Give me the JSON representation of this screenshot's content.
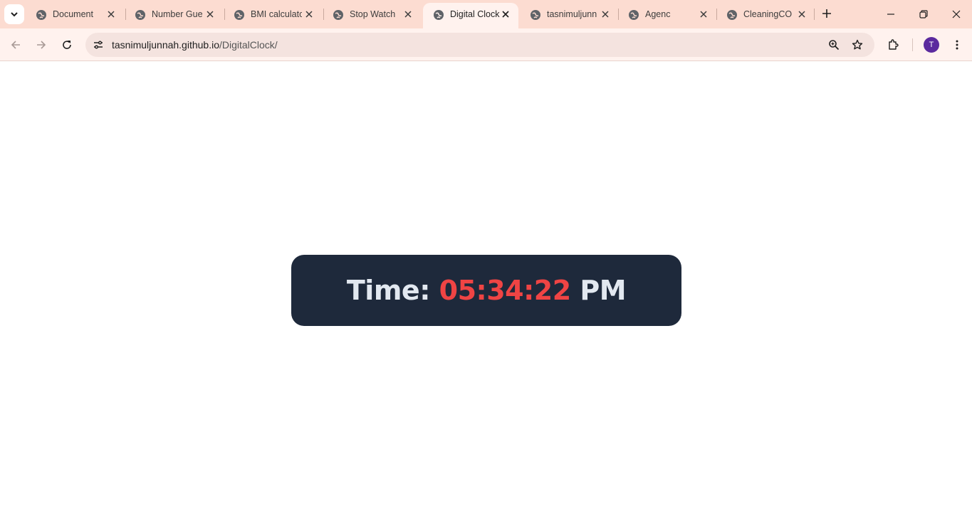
{
  "browser": {
    "tabs": [
      {
        "title": "Document"
      },
      {
        "title": "Number Gue"
      },
      {
        "title": "BMI calculato"
      },
      {
        "title": "Stop Watch"
      },
      {
        "title": "Digital Clock",
        "active": true
      },
      {
        "title": "tasnimuljunn"
      },
      {
        "title": "Agenc"
      },
      {
        "title": "CleaningCO"
      }
    ],
    "address": {
      "host": "tasnimuljunnah.github.io",
      "path": "/DigitalClock/"
    },
    "profile_initial": "T"
  },
  "clock": {
    "label": "Time:",
    "time": "05:34:22",
    "period": "PM"
  },
  "colors": {
    "tab_strip": "#fcdcd1",
    "toolbar": "#fff2ee",
    "clock_background": "#1e293b",
    "clock_text": "#e2e8f0",
    "clock_time": "#ef4444",
    "avatar": "#5b2a9e"
  }
}
